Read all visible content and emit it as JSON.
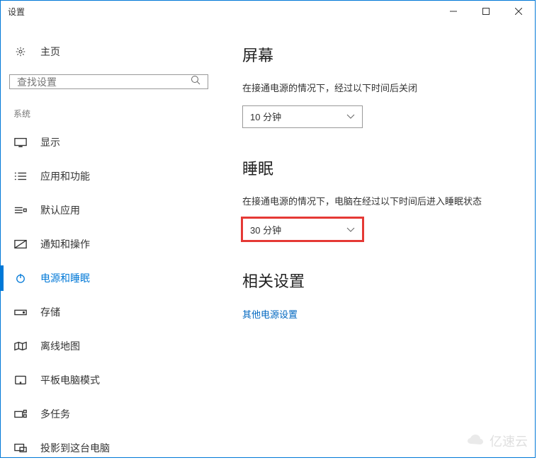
{
  "titlebar": {
    "title": "设置"
  },
  "sidebar": {
    "home_label": "主页",
    "search_placeholder": "查找设置",
    "category_label": "系统",
    "items": [
      {
        "label": "显示"
      },
      {
        "label": "应用和功能"
      },
      {
        "label": "默认应用"
      },
      {
        "label": "通知和操作"
      },
      {
        "label": "电源和睡眠"
      },
      {
        "label": "存储"
      },
      {
        "label": "离线地图"
      },
      {
        "label": "平板电脑模式"
      },
      {
        "label": "多任务"
      },
      {
        "label": "投影到这台电脑"
      }
    ]
  },
  "main": {
    "screen": {
      "title": "屏幕",
      "text": "在接通电源的情况下，经过以下时间后关闭",
      "value": "10 分钟"
    },
    "sleep": {
      "title": "睡眠",
      "text": "在接通电源的情况下，电脑在经过以下时间后进入睡眠状态",
      "value": "30 分钟"
    },
    "related": {
      "title": "相关设置",
      "link_label": "其他电源设置"
    }
  },
  "watermark": "亿速云"
}
